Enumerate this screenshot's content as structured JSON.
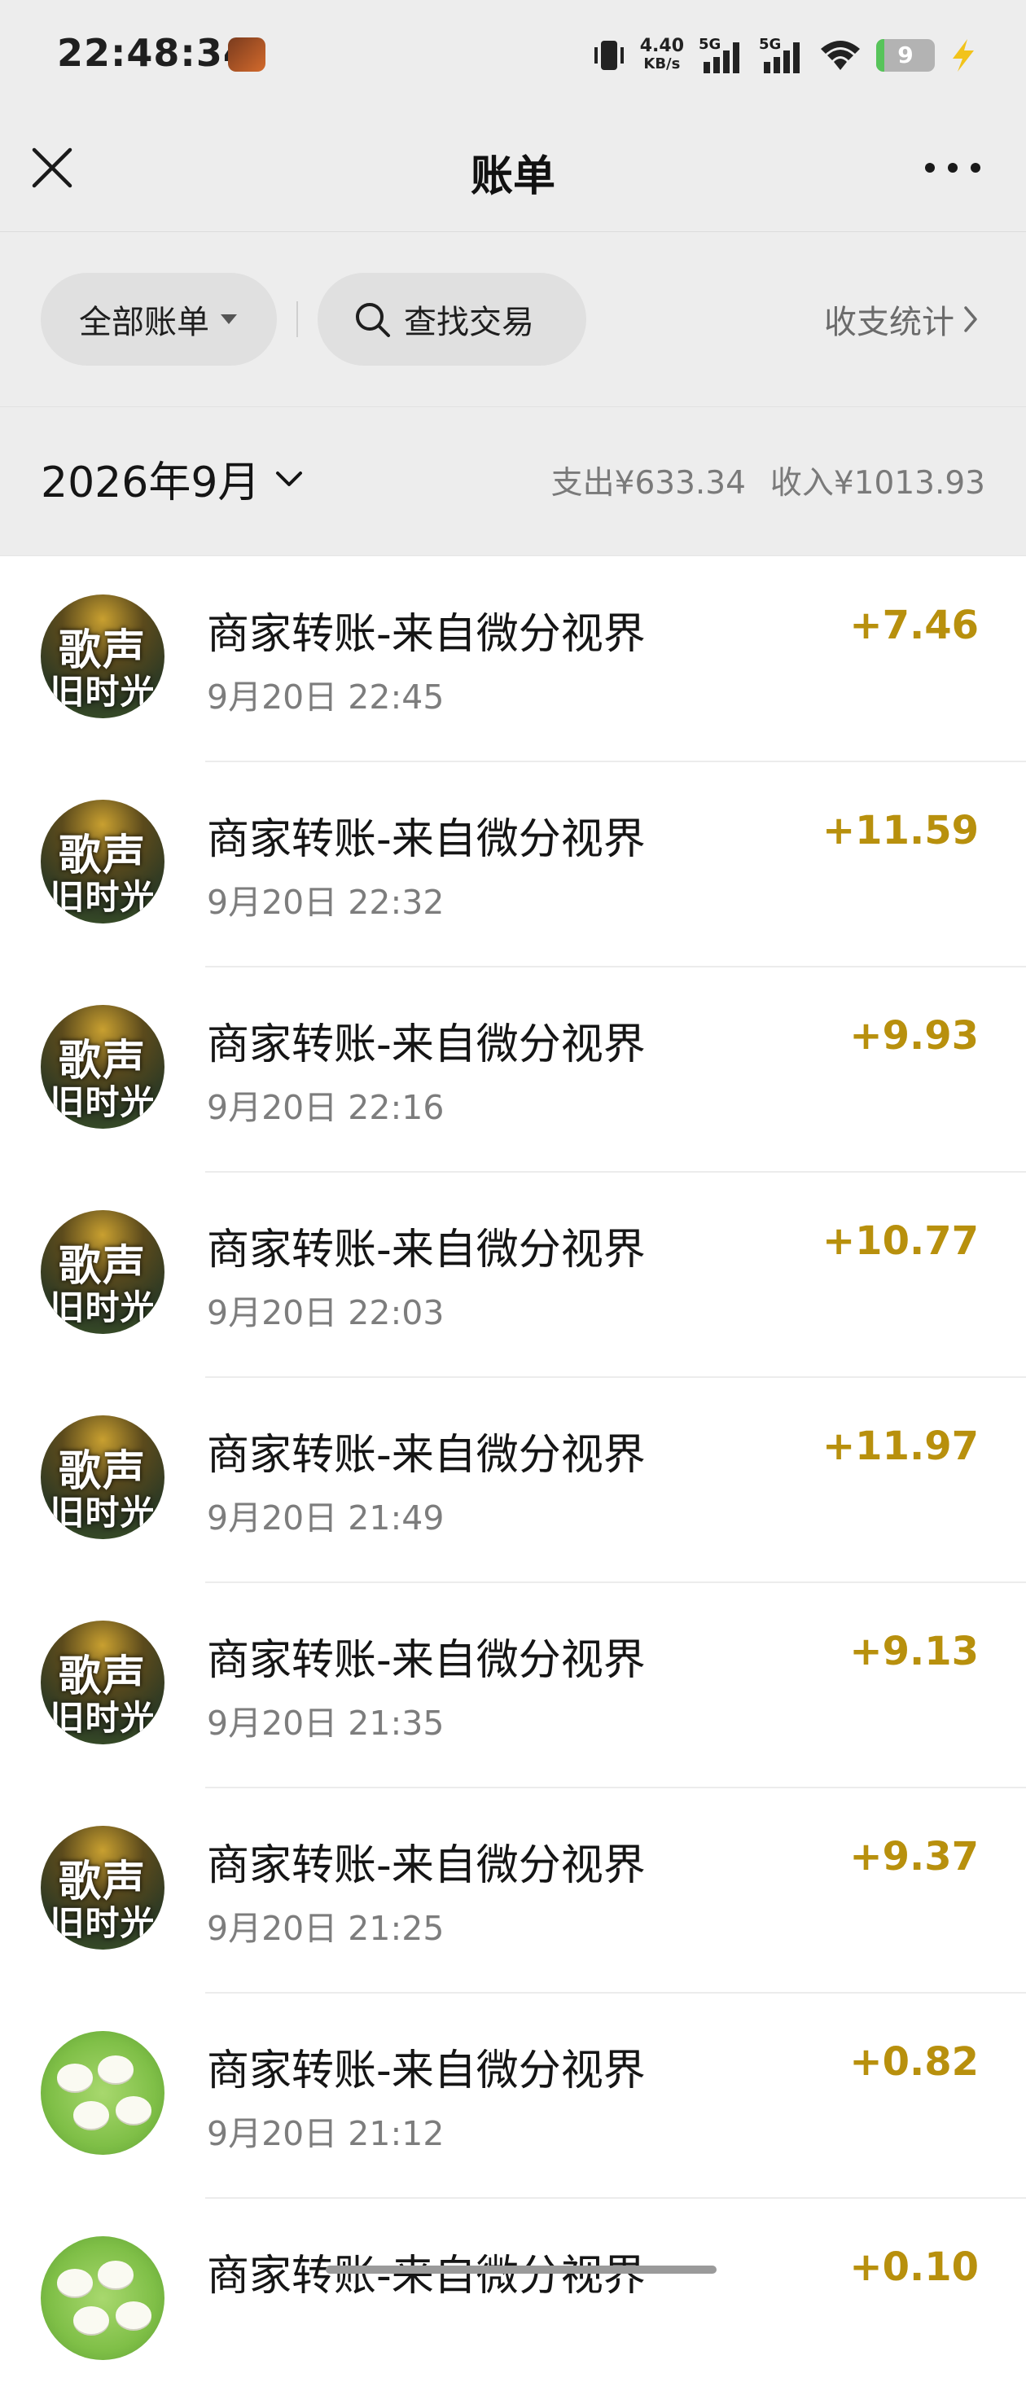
{
  "status_bar": {
    "time": "22:48:34",
    "net_speed": "4.40",
    "net_unit": "KB/s",
    "sim1": "5G",
    "sim2": "5G",
    "battery": "9"
  },
  "header": {
    "title": "账单"
  },
  "filters": {
    "all_bills": "全部账单",
    "search": "查找交易",
    "stats": "收支统计"
  },
  "month": {
    "label": "2026年9月",
    "expense": "支出¥633.34",
    "income": "收入¥1013.93"
  },
  "transactions": [
    {
      "title": "商家转账-来自微分视界",
      "time": "9月20日 22:45",
      "amount": "+7.46",
      "avatar": "song-avatar"
    },
    {
      "title": "商家转账-来自微分视界",
      "time": "9月20日 22:32",
      "amount": "+11.59",
      "avatar": "song-avatar"
    },
    {
      "title": "商家转账-来自微分视界",
      "time": "9月20日 22:16",
      "amount": "+9.93",
      "avatar": "song-avatar"
    },
    {
      "title": "商家转账-来自微分视界",
      "time": "9月20日 22:03",
      "amount": "+10.77",
      "avatar": "song-avatar"
    },
    {
      "title": "商家转账-来自微分视界",
      "time": "9月20日 21:49",
      "amount": "+11.97",
      "avatar": "song-avatar"
    },
    {
      "title": "商家转账-来自微分视界",
      "time": "9月20日 21:35",
      "amount": "+9.13",
      "avatar": "song-avatar"
    },
    {
      "title": "商家转账-来自微分视界",
      "time": "9月20日 21:25",
      "amount": "+9.37",
      "avatar": "song-avatar"
    },
    {
      "title": "商家转账-来自微分视界",
      "time": "9月20日 21:12",
      "amount": "+0.82",
      "avatar": "sheep-avatar"
    },
    {
      "title": "商家转账-来自微分视界",
      "time": "",
      "amount": "+0.10",
      "avatar": "sheep-avatar"
    }
  ],
  "avatar_text": {
    "line1": "歌声",
    "line2": "旧时光"
  },
  "colors": {
    "income": "#b8900d",
    "header_bg": "#ededed"
  }
}
